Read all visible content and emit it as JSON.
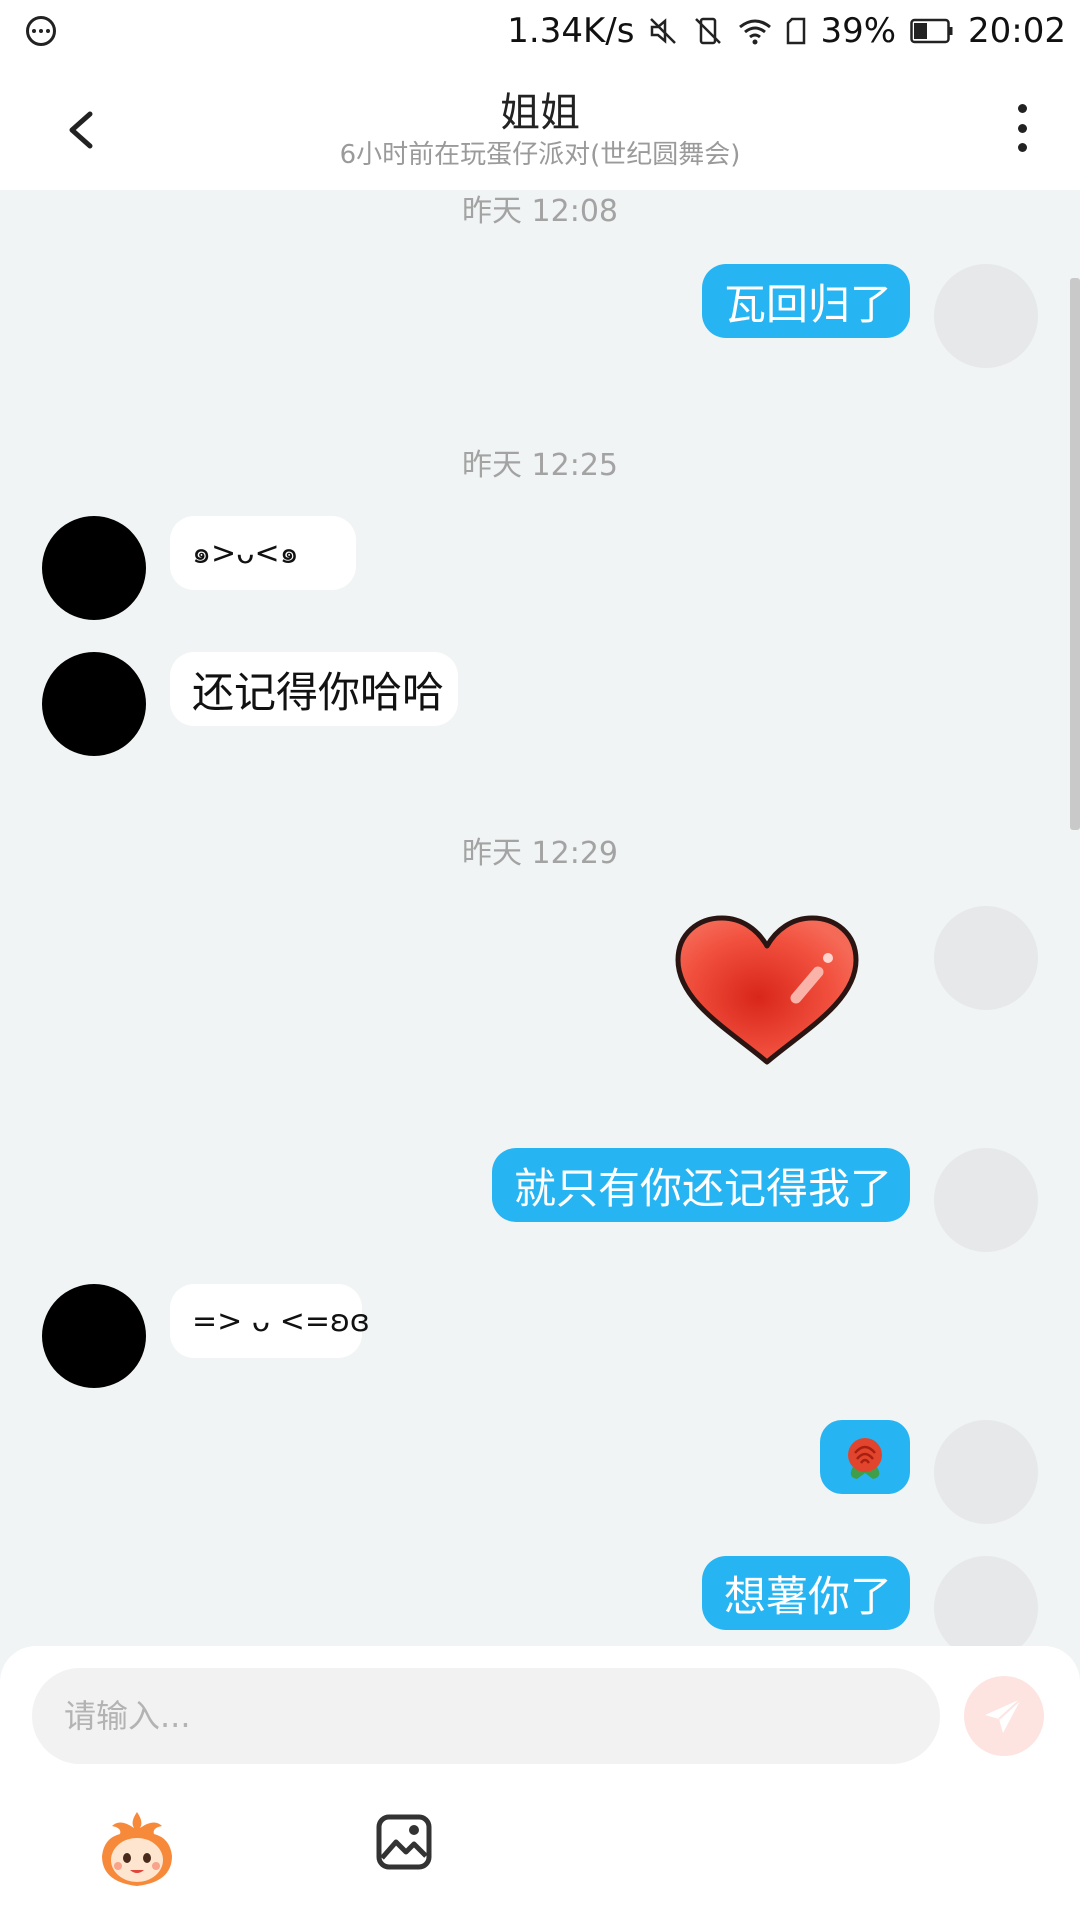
{
  "status_bar": {
    "network_speed": "1.34K/s",
    "battery": "39%",
    "time": "20:02",
    "icons": [
      "message-icon",
      "mute-icon",
      "vibrate-off-icon",
      "wifi-icon",
      "sim-icon",
      "battery-icon"
    ]
  },
  "header": {
    "title": "姐姐",
    "subtitle": "6小时前在玩蛋仔派对(世纪圆舞会)",
    "icons": [
      "back-arrow-icon",
      "more-vertical-icon"
    ]
  },
  "messages": {
    "ts1": "昨天 12:08",
    "m1": "瓦回归了",
    "ts2": "昨天 12:25",
    "m2": "๑>ᴗ<๑",
    "m3": "还记得你哈哈",
    "ts3": "昨天 12:29",
    "m4_sticker": "heart-sticker",
    "m5": "就只有你还记得我了",
    "m6": "=> ᴗ <=ʚɞ",
    "m7_sticker": "rose-emoji",
    "m8": "想薯你了"
  },
  "composer": {
    "placeholder": "请输入...",
    "icons": [
      "send-icon",
      "eggy-mascot-icon",
      "image-icon"
    ]
  },
  "colors": {
    "outgoing_bubble": "#26b4f2",
    "incoming_bubble": "#ffffff",
    "background": "#f1f4f5",
    "send_button": "#fde4e0"
  }
}
